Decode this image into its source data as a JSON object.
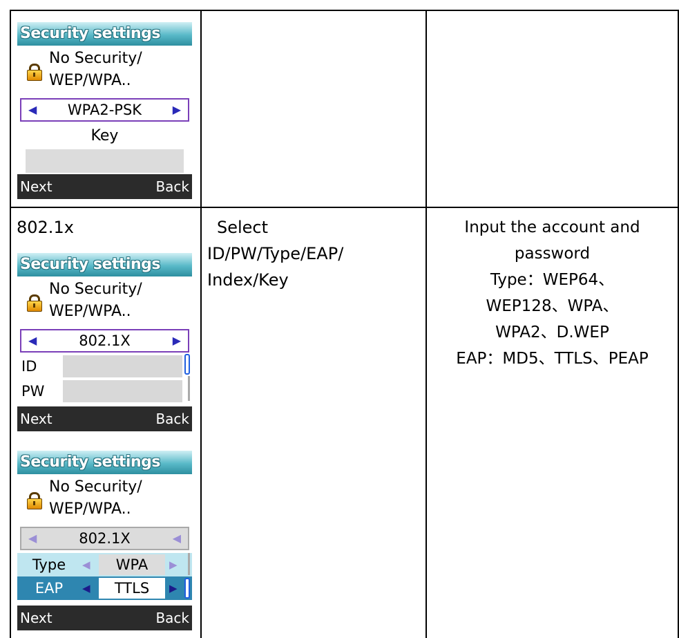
{
  "row1": {
    "screen": {
      "title": "Security settings",
      "security_line1": "No Security/",
      "security_line2": "WEP/WPA..",
      "mode": "WPA2-PSK",
      "key_label": "Key",
      "softkey_left": "Next",
      "softkey_right": "Back"
    }
  },
  "row2": {
    "col1_label": "802.1x",
    "screen1": {
      "title": "Security settings",
      "security_line1": "No Security/",
      "security_line2": "WEP/WPA..",
      "mode": "802.1X",
      "id_label": "ID",
      "pw_label": "PW",
      "softkey_left": "Next",
      "softkey_right": "Back"
    },
    "screen2": {
      "title": "Security settings",
      "security_line1": "No Security/",
      "security_line2": "WEP/WPA..",
      "mode": "802.1X",
      "type_label": "Type",
      "type_value": "WPA",
      "eap_label": "EAP",
      "eap_value": "TTLS",
      "softkey_left": "Next",
      "softkey_right": "Back"
    },
    "col2_lines": [
      "Select",
      "ID/PW/Type/EAP/",
      "Index/Key"
    ],
    "col3_lines": [
      "Input the account and",
      "password",
      "Type：WEP64、",
      "WEP128、WPA、",
      "WPA2、D.WEP",
      "EAP：MD5、TTLS、PEAP"
    ]
  },
  "colors": {
    "title_bar": "#59b9c8",
    "softkey_bar": "#2b2b2b",
    "selector_border": "#7a3fb8",
    "arrow": "#2a2ab8",
    "highlight_row": "#bfe6f0",
    "selected_row": "#2e86b0"
  }
}
